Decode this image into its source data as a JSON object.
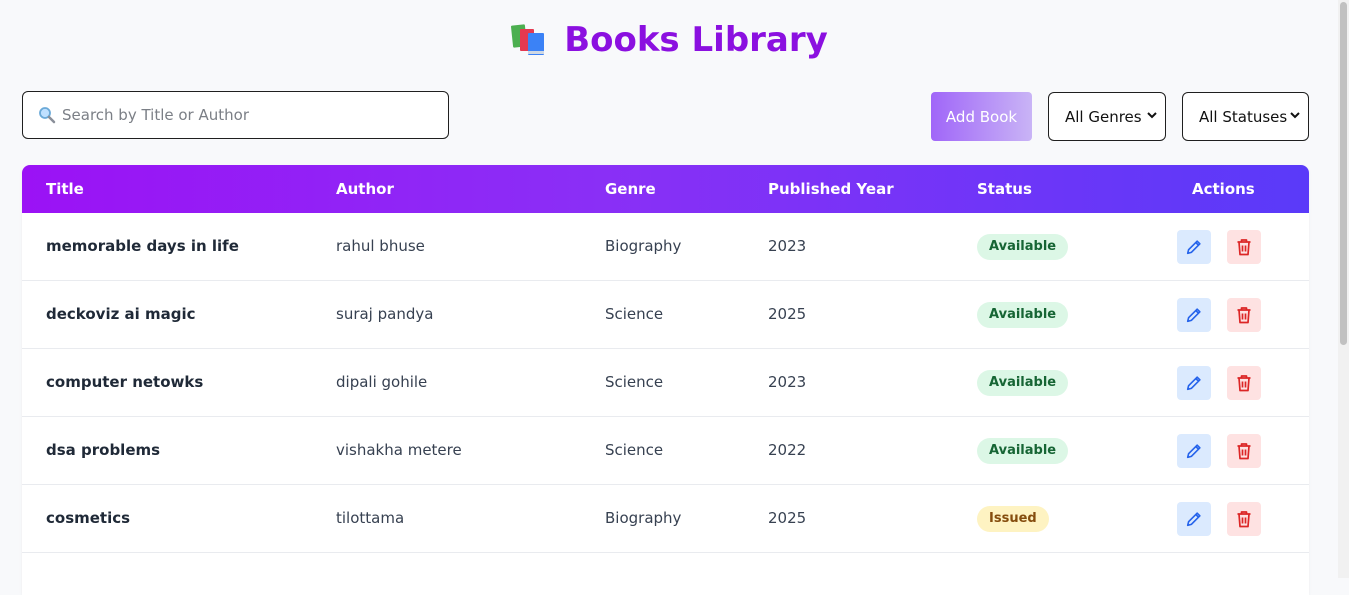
{
  "header": {
    "title": "Books Library",
    "icon": "books-icon"
  },
  "toolbar": {
    "search_placeholder": "Search by Title or Author",
    "search_value": "",
    "add_label": "Add Book",
    "genre_selected": "All Genres",
    "status_selected": "All Statuses"
  },
  "table": {
    "headers": [
      "Title",
      "Author",
      "Genre",
      "Published Year",
      "Status",
      "Actions"
    ],
    "rows": [
      {
        "title": "memorable days in life",
        "author": "rahul bhuse",
        "genre": "Biography",
        "year": "2023",
        "status": "Available"
      },
      {
        "title": "deckoviz ai magic",
        "author": "suraj pandya",
        "genre": "Science",
        "year": "2025",
        "status": "Available"
      },
      {
        "title": "computer netowks",
        "author": "dipali gohile",
        "genre": "Science",
        "year": "2023",
        "status": "Available"
      },
      {
        "title": "dsa problems",
        "author": "vishakha metere",
        "genre": "Science",
        "year": "2022",
        "status": "Available"
      },
      {
        "title": "cosmetics",
        "author": "tilottama",
        "genre": "Biography",
        "year": "2025",
        "status": "Issued"
      }
    ]
  },
  "colors": {
    "title": "#8b10e0",
    "header_gradient_start": "#9b12f5",
    "header_gradient_end": "#5a3af9",
    "available_bg": "#dcf7e6",
    "issued_bg": "#fef3c2",
    "edit_bg": "#dbeafe",
    "delete_bg": "#fee2e2"
  }
}
